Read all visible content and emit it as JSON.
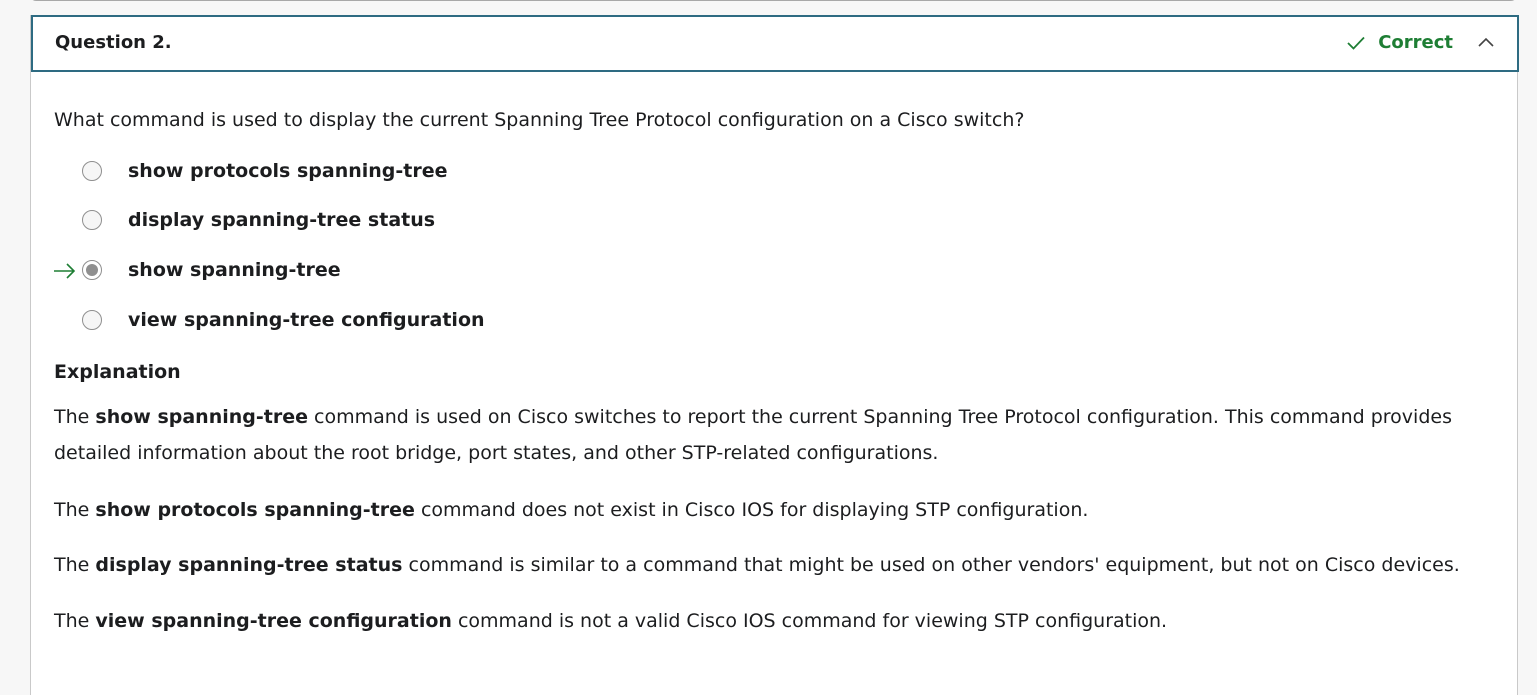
{
  "question": {
    "title": "Question 2.",
    "status_label": "Correct",
    "status_color": "#1e7e34",
    "text": "What command is used to display the current Spanning Tree Protocol configuration on a Cisco switch?"
  },
  "options": [
    {
      "label": "show protocols spanning-tree",
      "selected": false
    },
    {
      "label": "display spanning-tree status",
      "selected": false
    },
    {
      "label": "show spanning-tree",
      "selected": true
    },
    {
      "label": "view spanning-tree configuration",
      "selected": false
    }
  ],
  "explanation": {
    "heading": "Explanation",
    "paragraphs": [
      {
        "pre": "The ",
        "bold": "show spanning-tree",
        "post": " command is used on Cisco switches to report the current Spanning Tree Protocol configuration. This command provides detailed information about the root bridge, port states, and other STP-related configurations."
      },
      {
        "pre": "The ",
        "bold": "show protocols spanning-tree",
        "post": " command does not exist in Cisco IOS for displaying STP configuration."
      },
      {
        "pre": "The ",
        "bold": "display spanning-tree status",
        "post": " command is similar to a command that might be used on other vendors' equipment, but not on Cisco devices."
      },
      {
        "pre": "The ",
        "bold": "view spanning-tree configuration",
        "post": " command is not a valid Cisco IOS command for viewing STP configuration."
      }
    ]
  },
  "icons": {
    "status": "checkmark-icon",
    "collapse": "chevron-up-icon",
    "selected_marker": "arrow-right-icon"
  }
}
